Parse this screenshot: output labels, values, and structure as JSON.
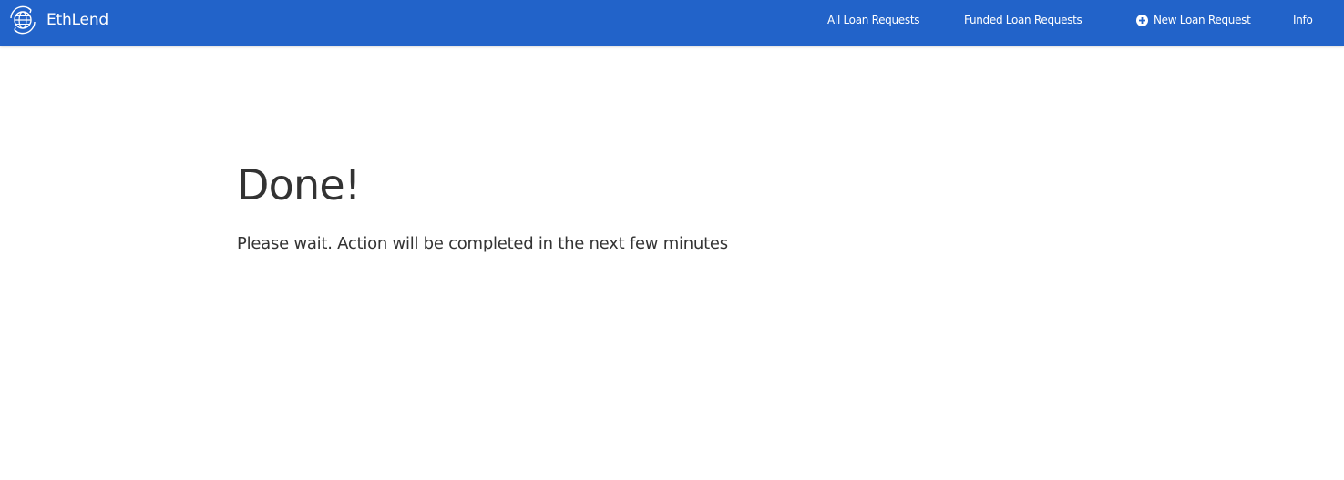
{
  "header": {
    "brand_name": "EthLend",
    "brand_icon": "globe-refresh-icon",
    "background_color": "#2263c9",
    "nav": {
      "all_loan_requests": "All Loan Requests",
      "funded_loan_requests": "Funded Loan Requests",
      "new_loan_request": "New Loan Request",
      "new_loan_request_icon": "plus-circle-icon",
      "info": "Info"
    }
  },
  "main": {
    "title": "Done!",
    "message": "Please wait. Action will be completed in the next few minutes"
  }
}
